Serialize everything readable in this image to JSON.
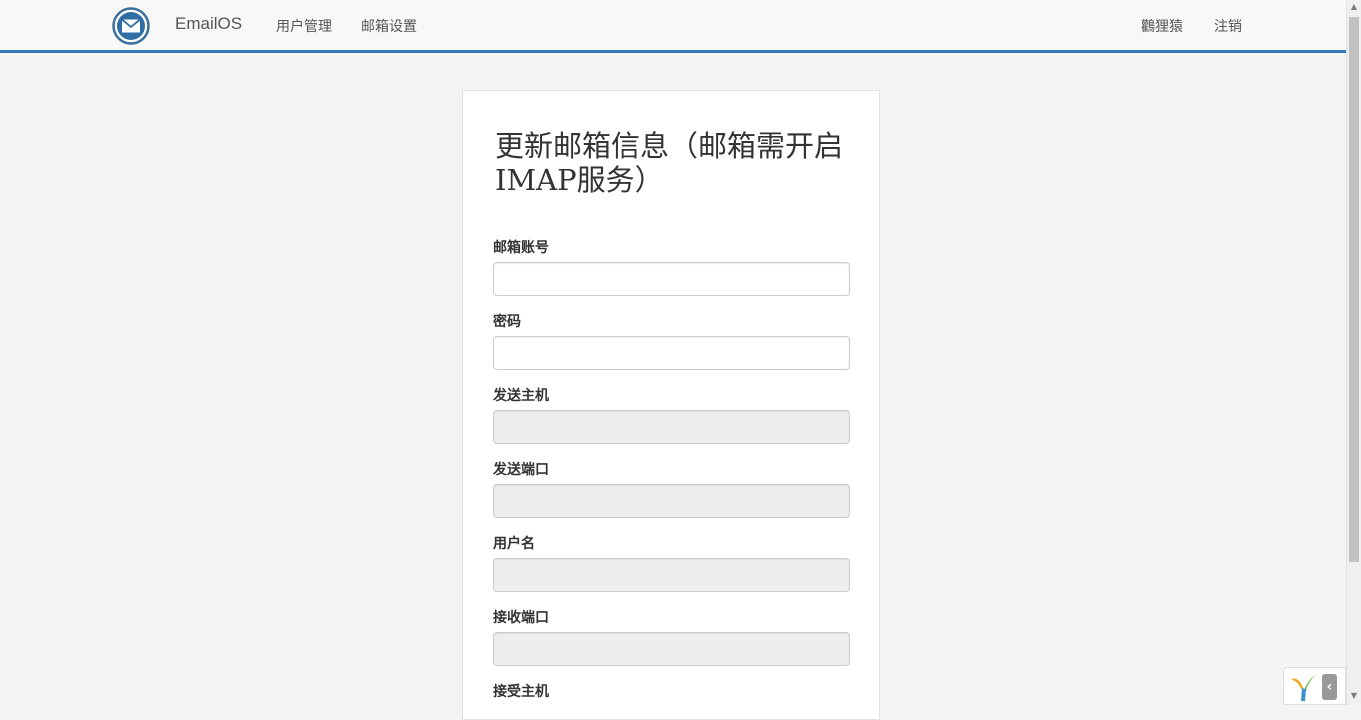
{
  "navbar": {
    "brand": "EmailOS",
    "links": [
      "用户管理",
      "邮箱设置"
    ],
    "user": "鸛狸猿",
    "logout": "注销"
  },
  "form": {
    "title": "更新邮箱信息（邮箱需开启IMAP服务）",
    "fields": [
      {
        "label": "邮箱账号",
        "value": "",
        "disabled": false
      },
      {
        "label": "密码",
        "value": "",
        "disabled": false
      },
      {
        "label": "发送主机",
        "value": "",
        "disabled": true
      },
      {
        "label": "发送端口",
        "value": "",
        "disabled": true
      },
      {
        "label": "用户名",
        "value": "",
        "disabled": true
      },
      {
        "label": "接收端口",
        "value": "",
        "disabled": true
      },
      {
        "label": "接受主机",
        "value": "",
        "disabled": true
      }
    ]
  },
  "colors": {
    "accent": "#337ab7",
    "page_bg": "#f4f4f4",
    "disabled_input": "#eeeeee"
  },
  "icons": {
    "brand": "envelope-icon",
    "debug_toolbar": "yii-logo-icon"
  }
}
